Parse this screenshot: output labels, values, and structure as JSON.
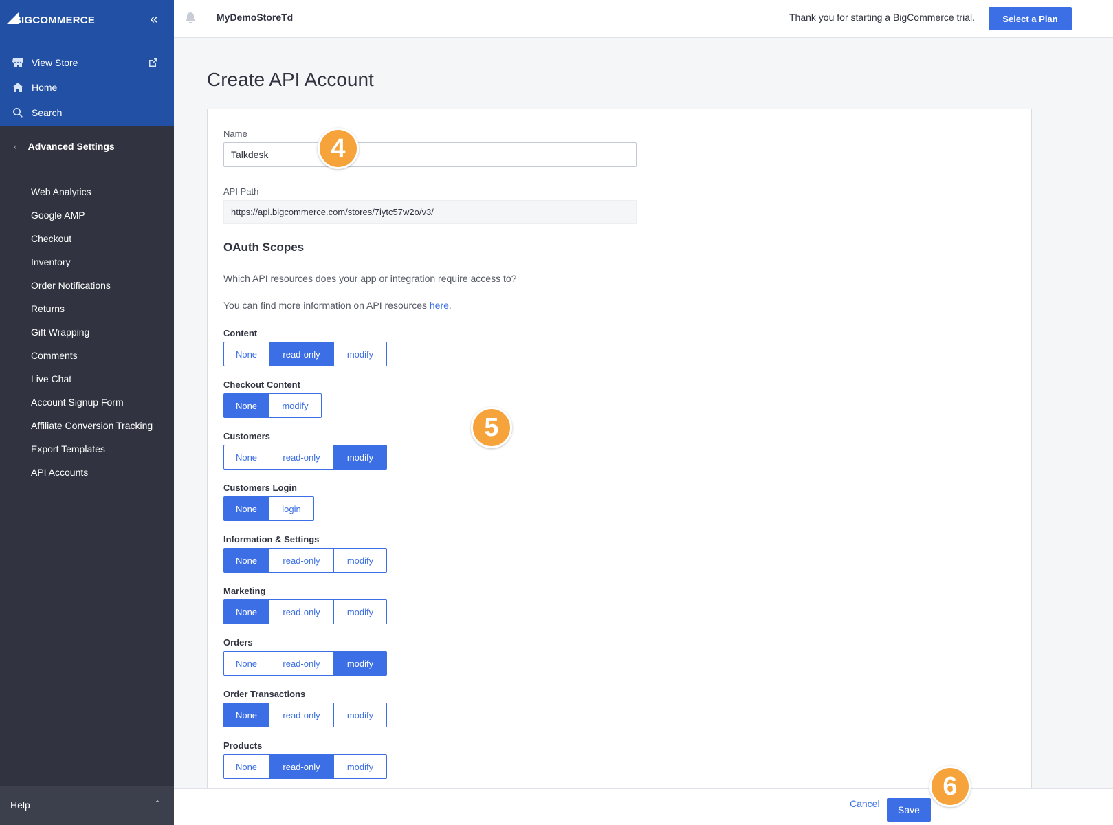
{
  "sidebar": {
    "logo": "BIGCOMMERCE",
    "collapse_glyph": "«",
    "view_store": "View Store",
    "home": "Home",
    "search": "Search",
    "section_title": "Advanced Settings",
    "items": [
      "Web Analytics",
      "Google AMP",
      "Checkout",
      "Inventory",
      "Order Notifications",
      "Returns",
      "Gift Wrapping",
      "Comments",
      "Live Chat",
      "Account Signup Form",
      "Affiliate Conversion Tracking",
      "Export Templates",
      "API Accounts"
    ],
    "help": "Help"
  },
  "topbar": {
    "store_name": "MyDemoStoreTd",
    "trial_text": "Thank you for starting a BigCommerce trial.",
    "select_plan": "Select a Plan"
  },
  "page": {
    "title": "Create API Account",
    "name_label": "Name",
    "name_value": "Talkdesk",
    "api_path_label": "API Path",
    "api_path_value": "https://api.bigcommerce.com/stores/7iytc57w2o/v3/",
    "oauth_title": "OAuth Scopes",
    "desc_1": "Which API resources does your app or integration require access to?",
    "desc_2_prefix": "You can find more information on API resources ",
    "desc_2_link": "here",
    "desc_2_suffix": "."
  },
  "scopes": [
    {
      "label": "Content",
      "options": [
        "None",
        "read-only",
        "modify"
      ],
      "selected": "read-only"
    },
    {
      "label": "Checkout Content",
      "options": [
        "None",
        "modify"
      ],
      "selected": "None"
    },
    {
      "label": "Customers",
      "options": [
        "None",
        "read-only",
        "modify"
      ],
      "selected": "modify"
    },
    {
      "label": "Customers Login",
      "options": [
        "None",
        "login"
      ],
      "selected": "None"
    },
    {
      "label": "Information & Settings",
      "options": [
        "None",
        "read-only",
        "modify"
      ],
      "selected": "None"
    },
    {
      "label": "Marketing",
      "options": [
        "None",
        "read-only",
        "modify"
      ],
      "selected": "None"
    },
    {
      "label": "Orders",
      "options": [
        "None",
        "read-only",
        "modify"
      ],
      "selected": "modify"
    },
    {
      "label": "Order Transactions",
      "options": [
        "None",
        "read-only",
        "modify"
      ],
      "selected": "None"
    },
    {
      "label": "Products",
      "options": [
        "None",
        "read-only",
        "modify"
      ],
      "selected": "read-only"
    }
  ],
  "footer": {
    "cancel": "Cancel",
    "save": "Save"
  },
  "badges": {
    "step4": "4",
    "step5": "5",
    "step6": "6"
  },
  "colors": {
    "accent": "#3c6fe6",
    "sidebar_top": "#2150a5",
    "sidebar": "#313440",
    "badge": "#f5a33a"
  }
}
